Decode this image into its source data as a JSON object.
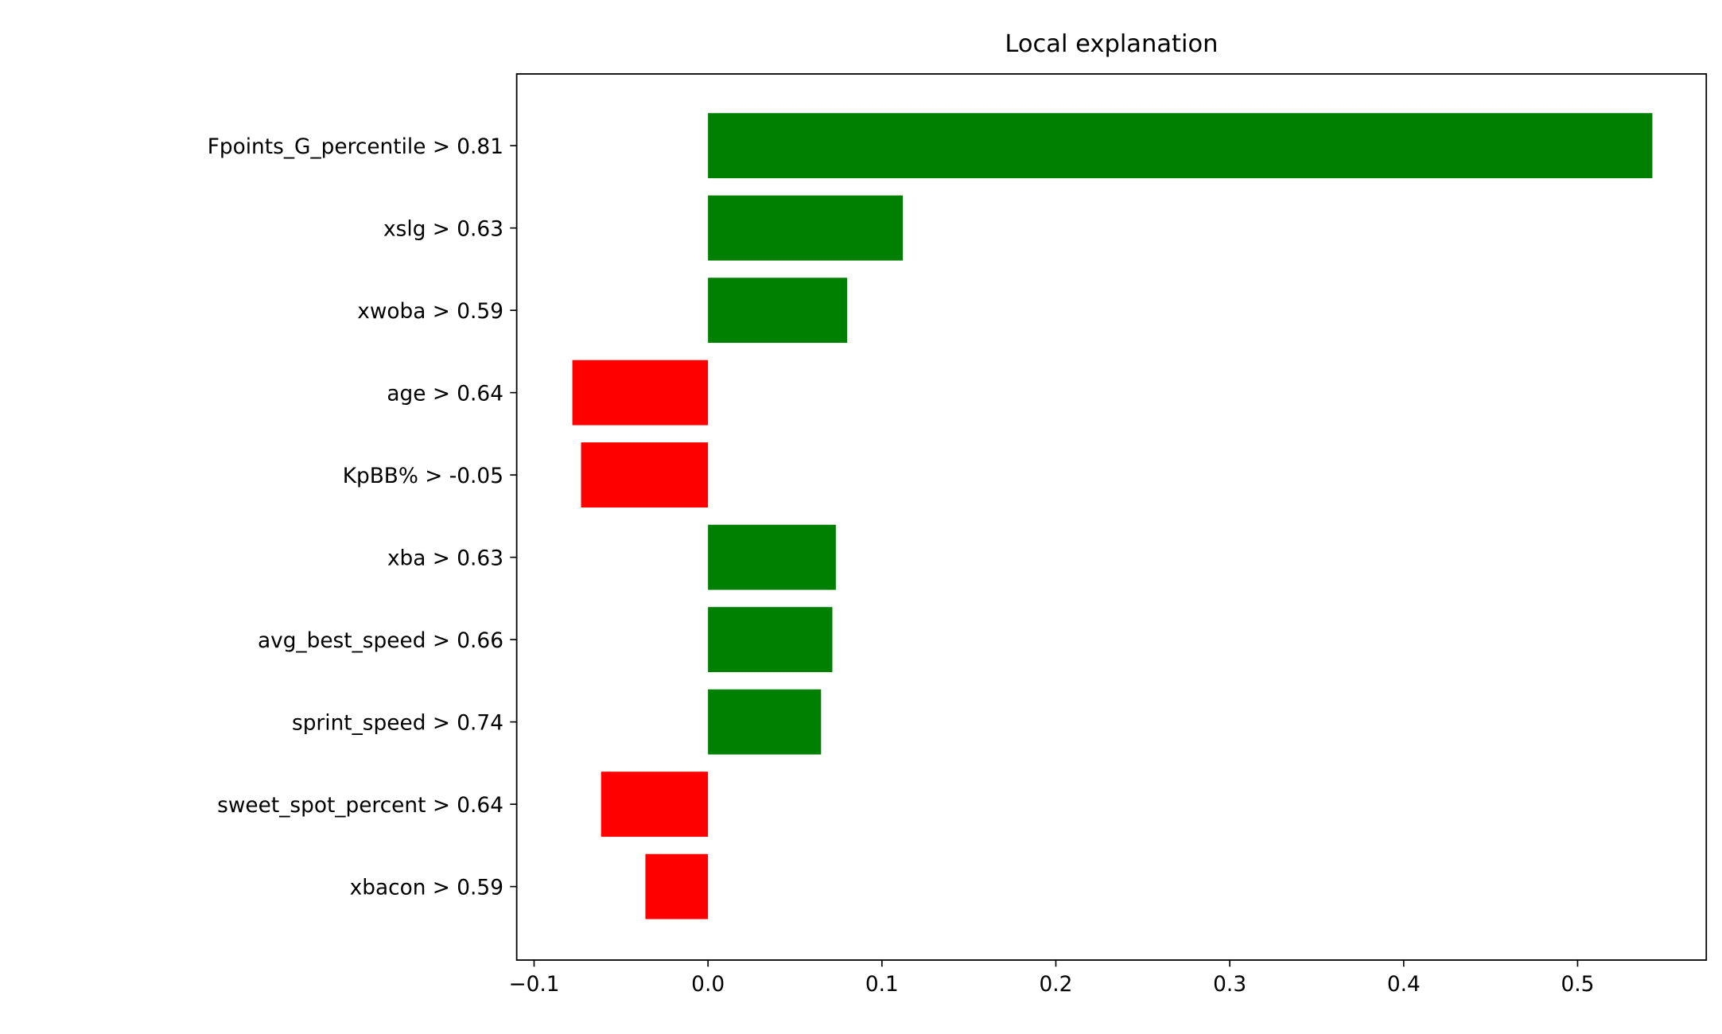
{
  "chart_data": {
    "type": "bar",
    "orientation": "horizontal",
    "title": "Local explanation",
    "xlabel": "",
    "ylabel": "",
    "categories": [
      "Fpoints_G_percentile > 0.81",
      "xslg > 0.63",
      "xwoba > 0.59",
      "age > 0.64",
      "KpBB% > -0.05",
      "xba > 0.63",
      "avg_best_speed > 0.66",
      "sprint_speed > 0.74",
      "sweet_spot_percent > 0.64",
      "xbacon > 0.59"
    ],
    "values": [
      0.543,
      0.112,
      0.08,
      -0.078,
      -0.073,
      0.0735,
      0.0715,
      0.065,
      -0.0615,
      -0.036
    ],
    "xlim": [
      -0.11,
      0.574
    ],
    "xticks": [
      -0.1,
      0.0,
      0.1,
      0.2,
      0.3,
      0.4,
      0.5
    ],
    "xtick_labels": [
      "−0.1",
      "0.0",
      "0.1",
      "0.2",
      "0.3",
      "0.4",
      "0.5"
    ],
    "grid": false,
    "colors": {
      "positive": "#008000",
      "negative": "#ff0000"
    }
  }
}
